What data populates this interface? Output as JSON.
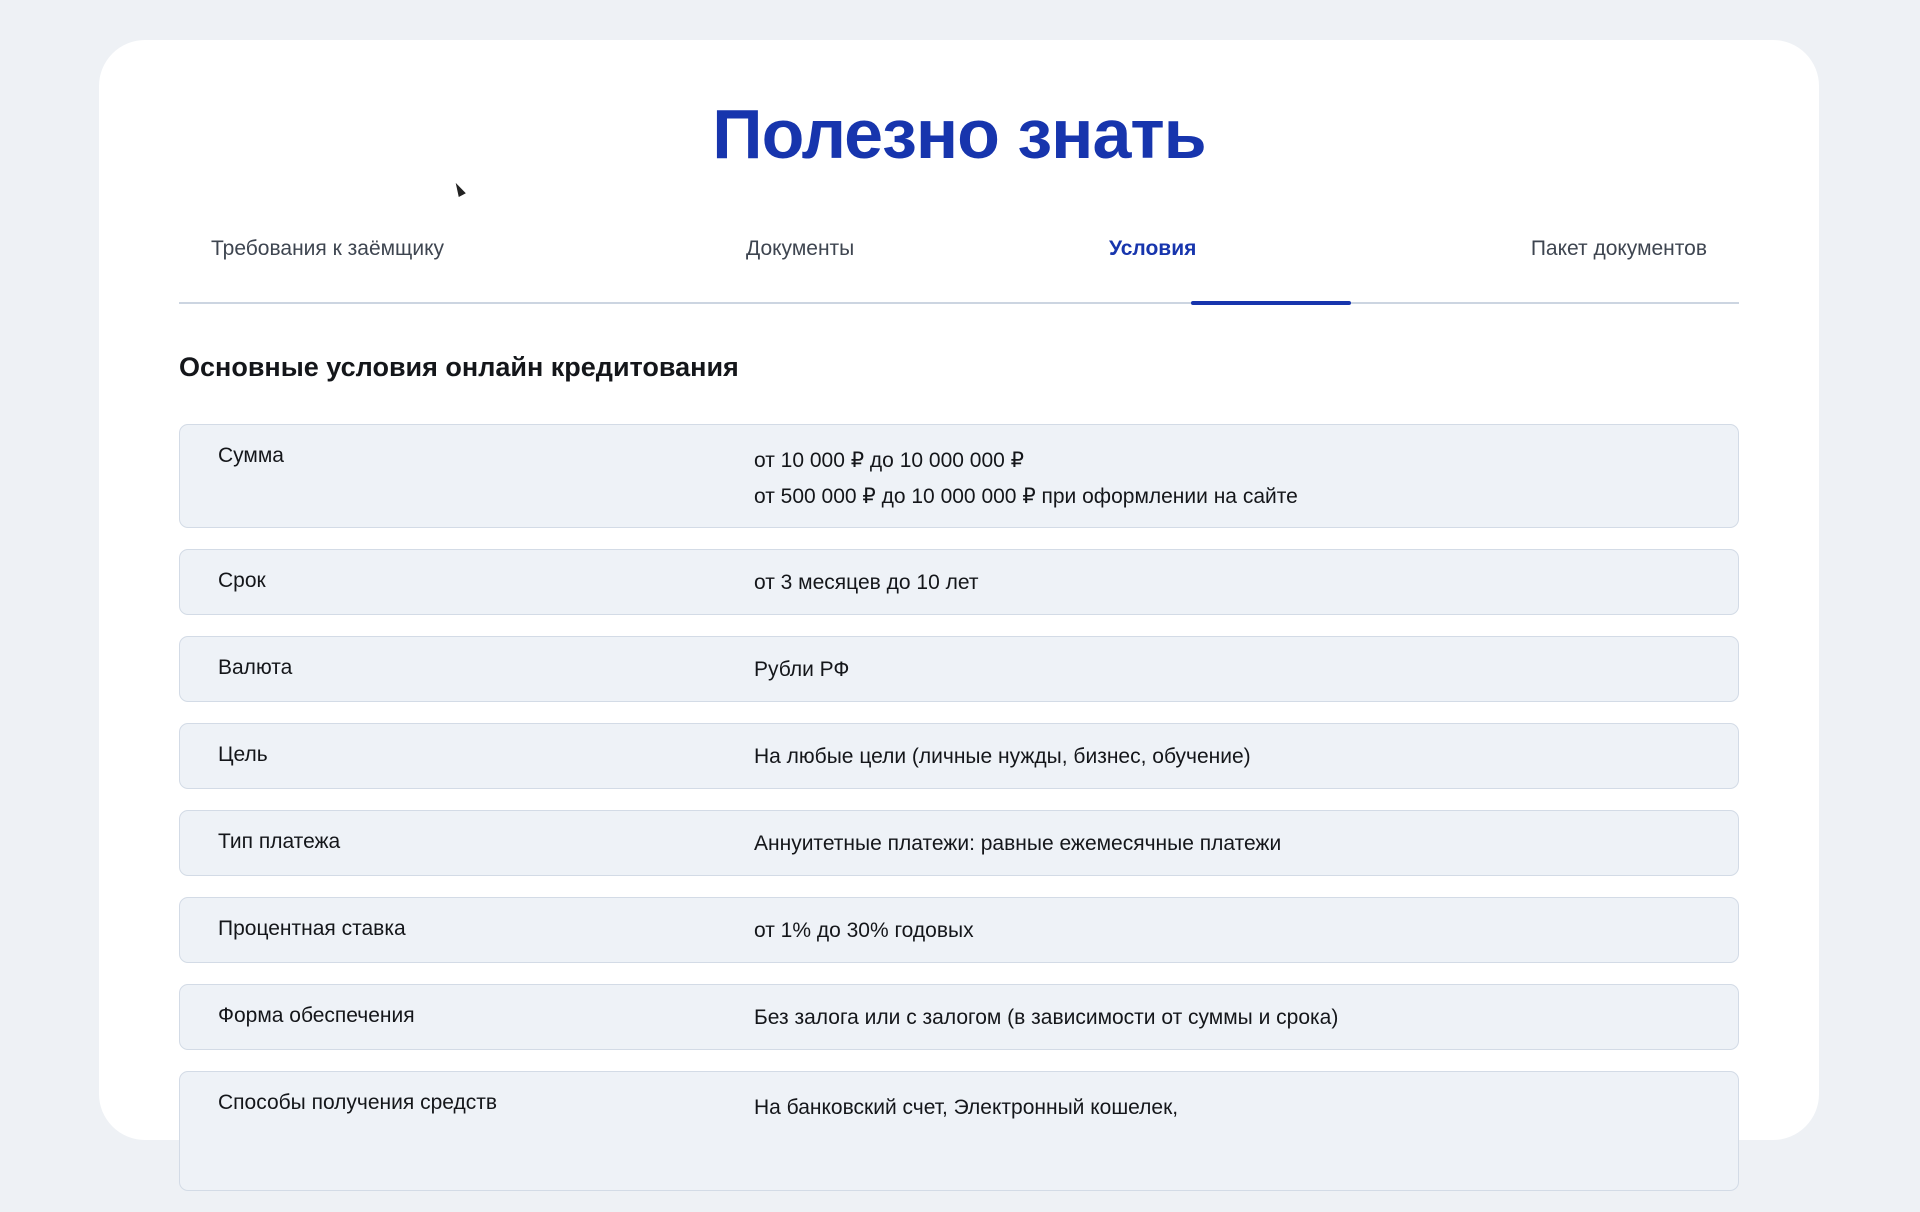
{
  "page": {
    "title": "Полезно знать"
  },
  "tabs": [
    {
      "label": "Требования к заёмщику",
      "active": false
    },
    {
      "label": "Документы",
      "active": false
    },
    {
      "label": "Условия",
      "active": true
    },
    {
      "label": "Пакет документов",
      "active": false
    }
  ],
  "section": {
    "title": "Основные условия онлайн кредитования"
  },
  "conditions": [
    {
      "label": "Сумма",
      "values": [
        "от 10 000 ₽ до 10 000 000 ₽",
        "от 500 000 ₽ до 10 000 000 ₽ при оформлении на сайте"
      ]
    },
    {
      "label": "Срок",
      "values": [
        "от 3 месяцев до 10 лет"
      ]
    },
    {
      "label": "Валюта",
      "values": [
        "Рубли РФ"
      ]
    },
    {
      "label": "Цель",
      "values": [
        "На любые цели (личные нужды, бизнес, обучение)"
      ]
    },
    {
      "label": "Тип платежа",
      "values": [
        "Аннуитетные платежи: равные ежемесячные платежи"
      ]
    },
    {
      "label": "Процентная ставка",
      "values": [
        "от 1% до 30% годовых"
      ]
    },
    {
      "label": "Форма обеспечения",
      "values": [
        "Без залога или с залогом (в зависимости от суммы и срока)"
      ]
    },
    {
      "label": "Способы получения средств",
      "values": [
        "На банковский счет, Электронный кошелек,"
      ]
    }
  ],
  "colors": {
    "accent": "#1735ad",
    "row_background": "#eef2f7",
    "page_background": "#eef1f5"
  }
}
